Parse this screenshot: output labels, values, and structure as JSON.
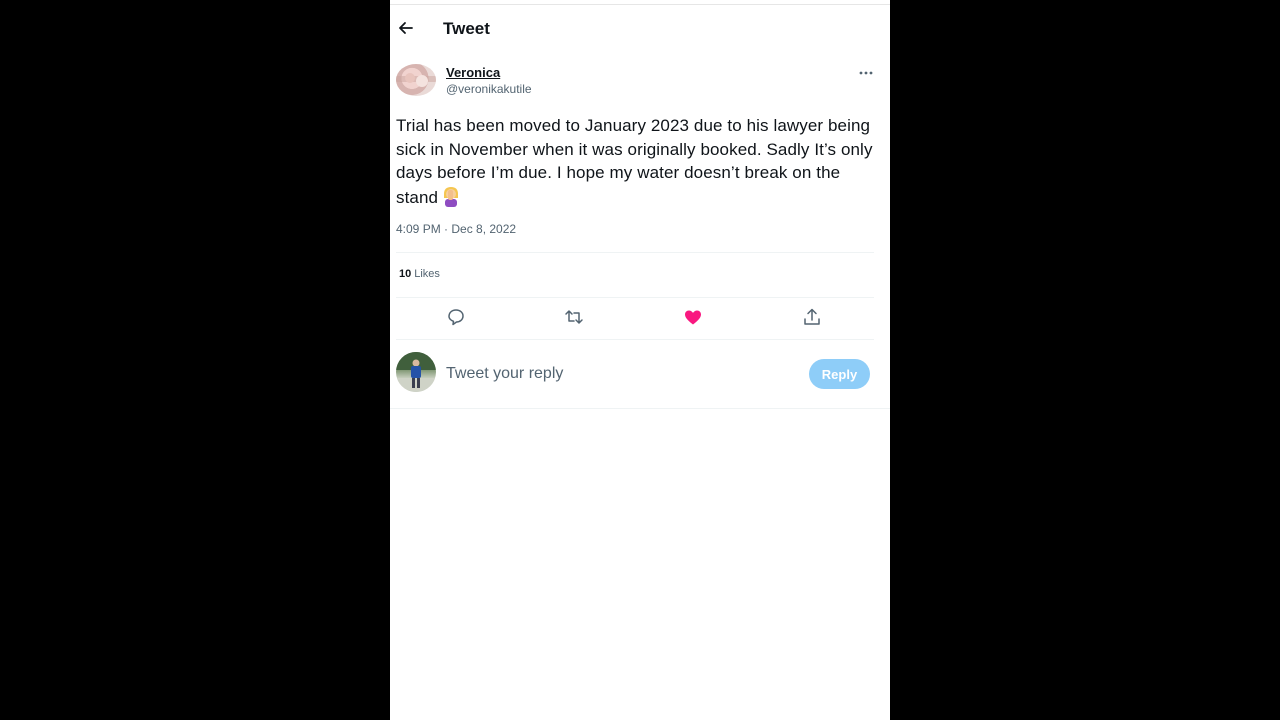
{
  "header": {
    "title": "Tweet"
  },
  "tweet": {
    "author": {
      "name": "Veronica",
      "handle": "@veronikakutile"
    },
    "text": "Trial has been moved to January 2023 due to his lawyer being sick in November when it was originally booked. Sadly It’s only days before I’m due. I hope my water doesn’t break on the stand",
    "timestamp": "4:09 PM · Dec 8, 2022",
    "likes": {
      "count": "10",
      "label": "Likes"
    },
    "liked": true
  },
  "icons": {
    "back": "arrow-left-icon",
    "more": "ellipsis-icon",
    "emoji": "woman-facepalming-emoji",
    "reply": "comment-icon",
    "retweet": "retweet-icon",
    "like": "heart-filled-icon",
    "share": "share-icon"
  },
  "composer": {
    "placeholder": "Tweet your reply",
    "button_label": "Reply"
  },
  "colors": {
    "like": "#f91880",
    "reply_button": "#8ecdf8",
    "secondary_text": "#536471"
  }
}
